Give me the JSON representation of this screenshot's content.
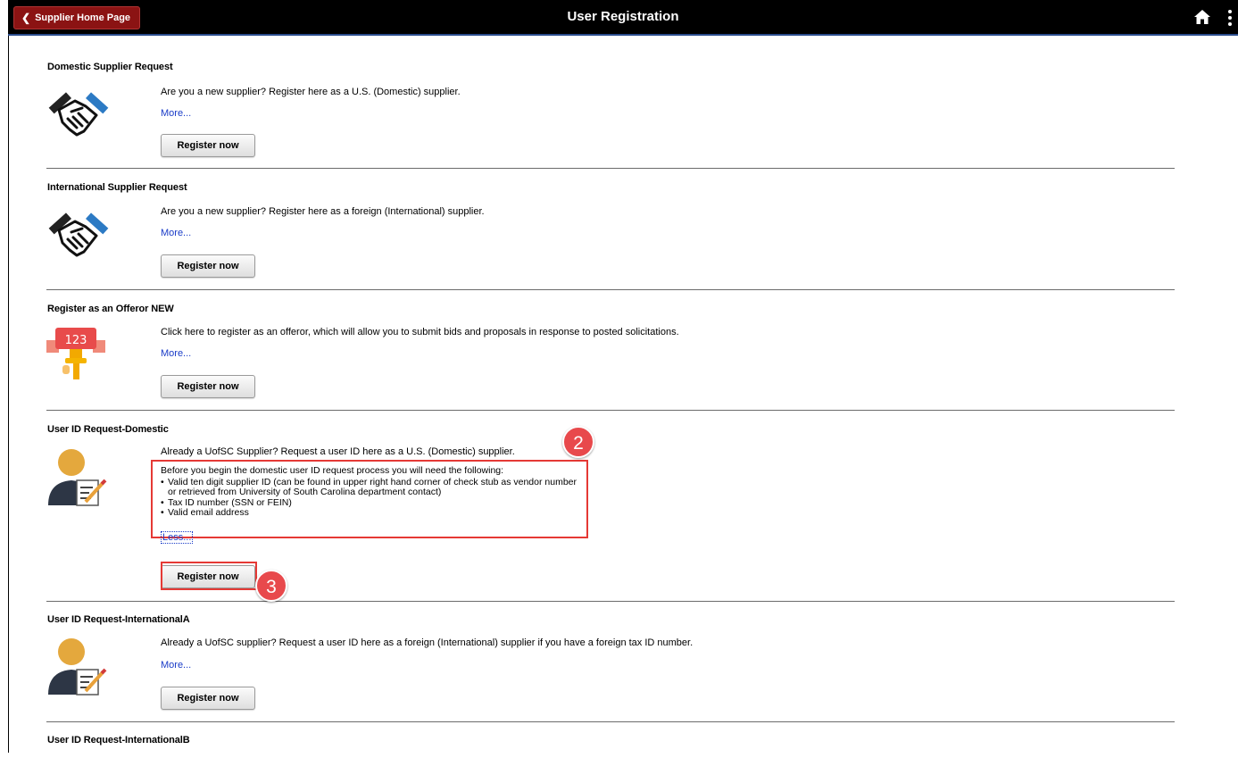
{
  "header": {
    "back_label": "Supplier Home Page",
    "title": "User Registration",
    "home_icon": "home-icon",
    "menu_icon": "kebab-menu-icon"
  },
  "colors": {
    "header_bg": "#000000",
    "back_button_bg": "#8b1313",
    "link": "#1a3cc8",
    "callout": "#e53935"
  },
  "sections": [
    {
      "title": "Domestic Supplier Request",
      "icon": "handshake-icon",
      "description": "Are you a new supplier? Register here as a U.S. (Domestic) supplier.",
      "link": "More...",
      "button": "Register now"
    },
    {
      "title": "International Supplier Request",
      "icon": "handshake-icon",
      "description": "Are you a new supplier? Register here as a foreign (International) supplier.",
      "link": "More...",
      "button": "Register now"
    },
    {
      "title": "Register as an Offeror NEW",
      "icon": "auction-gavel-icon",
      "icon_text": "123",
      "description": "Click here to register as an offeror, which will allow you to submit bids and proposals in response to posted solicitations.",
      "link": "More...",
      "button": "Register now"
    },
    {
      "title": "User ID Request-Domestic",
      "icon": "user-form-icon",
      "description": "Already a UofSC Supplier? Request a user ID here as a U.S. (Domestic) supplier.",
      "details_intro": "Before you begin the domestic user ID request process you will need the following:",
      "details_items": [
        "Valid ten digit supplier ID (can be found in upper right hand corner of check stub as vendor number or retrieved from University of South Carolina department contact)",
        "Tax ID number (SSN or FEIN)",
        "Valid email address"
      ],
      "link": "Less...",
      "button": "Register now",
      "callout_details": "2",
      "callout_button": "3"
    },
    {
      "title": "User ID Request-InternationalA",
      "icon": "user-form-icon",
      "description": "Already a UofSC supplier? Request a user ID here as a foreign (International) supplier if you have a foreign tax ID number.",
      "link": "More...",
      "button": "Register now"
    },
    {
      "title": "User ID Request-InternationalB"
    }
  ]
}
